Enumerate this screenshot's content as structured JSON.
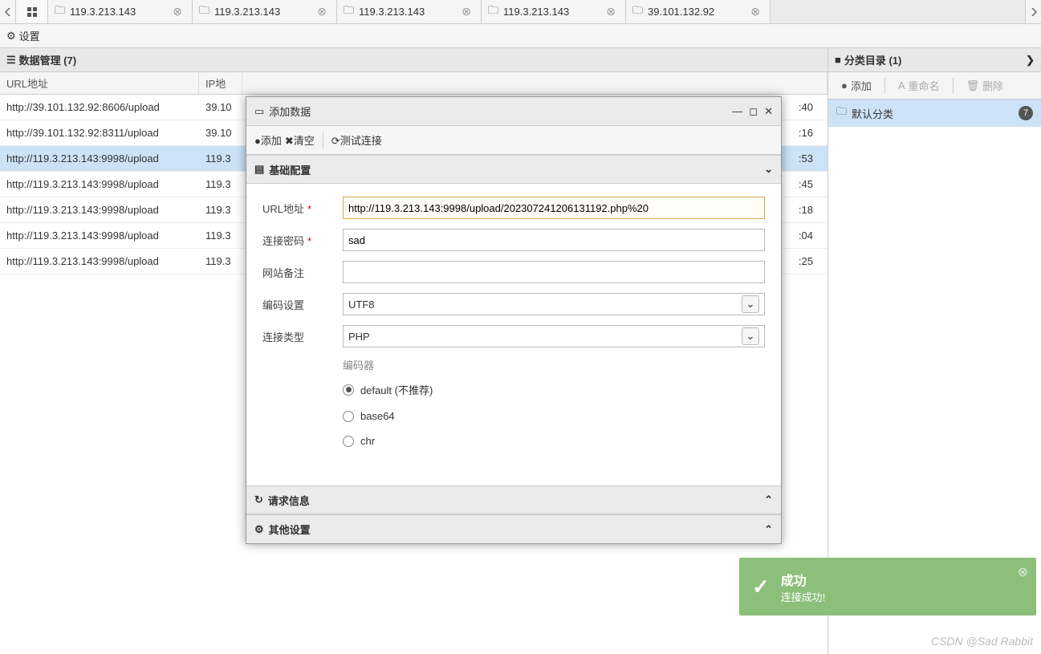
{
  "tabs": [
    {
      "label": "119.3.213.143"
    },
    {
      "label": "119.3.213.143"
    },
    {
      "label": "119.3.213.143"
    },
    {
      "label": "119.3.213.143"
    },
    {
      "label": "39.101.132.92"
    }
  ],
  "settings_label": "设置",
  "data_panel": {
    "title": "数据管理 (7)",
    "columns": {
      "url": "URL地址",
      "ip": "IP地"
    },
    "rows": [
      {
        "url": "http://39.101.132.92:8606/upload",
        "ip": "39.10",
        "time": ":40",
        "selected": false
      },
      {
        "url": "http://39.101.132.92:8311/upload",
        "ip": "39.10",
        "time": ":16",
        "selected": false
      },
      {
        "url": "http://119.3.213.143:9998/upload",
        "ip": "119.3",
        "time": ":53",
        "selected": true
      },
      {
        "url": "http://119.3.213.143:9998/upload",
        "ip": "119.3",
        "time": ":45",
        "selected": false
      },
      {
        "url": "http://119.3.213.143:9998/upload",
        "ip": "119.3",
        "time": ":18",
        "selected": false
      },
      {
        "url": "http://119.3.213.143:9998/upload",
        "ip": "119.3",
        "time": ":04",
        "selected": false
      },
      {
        "url": "http://119.3.213.143:9998/upload",
        "ip": "119.3",
        "time": ":25",
        "selected": false
      }
    ]
  },
  "category_panel": {
    "title": "分类目录 (1)",
    "add": "添加",
    "rename": "重命名",
    "delete": "删除",
    "items": [
      {
        "label": "默认分类",
        "count": "7"
      }
    ]
  },
  "modal": {
    "title": "添加数据",
    "toolbar": {
      "add": "添加",
      "clear": "清空",
      "test": "测试连接"
    },
    "accordion": {
      "basic": "基础配置",
      "request": "请求信息",
      "other": "其他设置"
    },
    "form": {
      "url_label": "URL地址",
      "url_value": "http://119.3.213.143:9998/upload/202307241206131192.php%20",
      "pwd_label": "连接密码",
      "pwd_value": "sad",
      "remark_label": "网站备注",
      "remark_value": "",
      "encoding_label": "编码设置",
      "encoding_value": "UTF8",
      "type_label": "连接类型",
      "type_value": "PHP",
      "encoder_label": "编码器",
      "encoders": [
        {
          "label": "default (不推荐)",
          "checked": true
        },
        {
          "label": "base64",
          "checked": false
        },
        {
          "label": "chr",
          "checked": false
        }
      ]
    }
  },
  "toast": {
    "title": "成功",
    "msg": "连接成功!"
  },
  "watermark": "CSDN @Sad Rabbit"
}
